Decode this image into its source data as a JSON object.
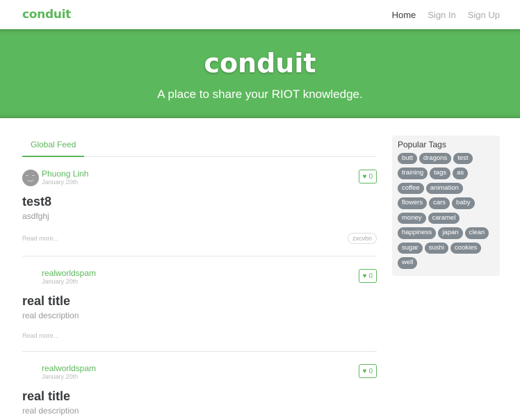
{
  "navbar": {
    "brand": "conduit",
    "links": [
      "Home",
      "Sign In",
      "Sign Up"
    ]
  },
  "banner": {
    "title": "conduit",
    "subtitle": "A place to share your RIOT knowledge."
  },
  "feed": {
    "tab_label": "Global Feed",
    "articles": [
      {
        "author": "Phuong Linh",
        "date": "January 20th",
        "favorites": "0",
        "title": "test8",
        "description": "asdfghj",
        "read_more": "Read more...",
        "tag": "zxcvbn"
      },
      {
        "author": "realworldspam",
        "date": "January 20th",
        "favorites": "0",
        "title": "real title",
        "description": "real description",
        "read_more": "Read more..."
      },
      {
        "author": "realworldspam",
        "date": "January 20th",
        "favorites": "0",
        "title": "real title",
        "description": "real description"
      }
    ]
  },
  "sidebar": {
    "title": "Popular Tags",
    "tags": [
      "butt",
      "dragons",
      "test",
      "training",
      "tags",
      "as",
      "coffee",
      "animation",
      "flowers",
      "cars",
      "baby",
      "money",
      "caramel",
      "happiness",
      "japan",
      "clean",
      "sugar",
      "sushi",
      "cookies",
      "well"
    ]
  },
  "colors": {
    "accent": "#5cb85c",
    "tag_bg": "#818a91"
  }
}
